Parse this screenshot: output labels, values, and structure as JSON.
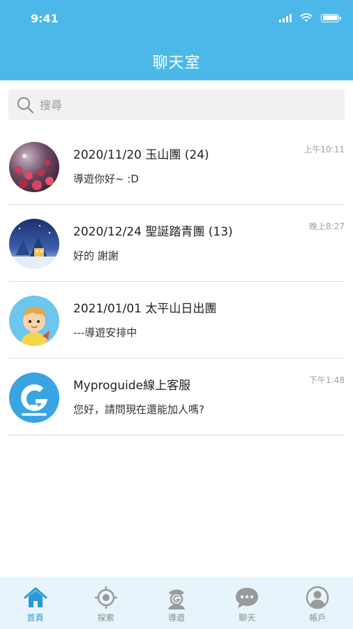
{
  "status_bar": {
    "time": "9:41"
  },
  "header": {
    "title": "聊天室"
  },
  "search": {
    "placeholder": "搜尋"
  },
  "chats": [
    {
      "name": "2020/11/20 玉山團 (24)",
      "message": "導遊你好~ :D",
      "time": "上午10:11",
      "avatar": "flowers-photo"
    },
    {
      "name": "2020/12/24 聖誕踏青團 (13)",
      "message": "好的 謝謝",
      "time": "晚上8:27",
      "avatar": "winter-night-photo"
    },
    {
      "name": "2021/01/01 太平山日出團",
      "message": "---導遊安排中",
      "time": "",
      "avatar": "cartoon-boy"
    },
    {
      "name": "Myproguide線上客服",
      "message": "您好，請問現在還能加人嗎?",
      "time": "下午1:48",
      "avatar": "myproguide-logo"
    }
  ],
  "tabs": [
    {
      "label": "首頁",
      "icon": "home-icon",
      "active": true
    },
    {
      "label": "探索",
      "icon": "target-icon",
      "active": false
    },
    {
      "label": "導遊",
      "icon": "guide-icon",
      "active": false
    },
    {
      "label": "聊天",
      "icon": "chat-bubble-icon",
      "active": false
    },
    {
      "label": "帳戶",
      "icon": "account-icon",
      "active": false
    }
  ],
  "colors": {
    "header": "#4cb8ea",
    "tabbar": "#e7f4fc",
    "active_tab": "#2a9ad6",
    "inactive_tab": "#8a8a8a"
  }
}
